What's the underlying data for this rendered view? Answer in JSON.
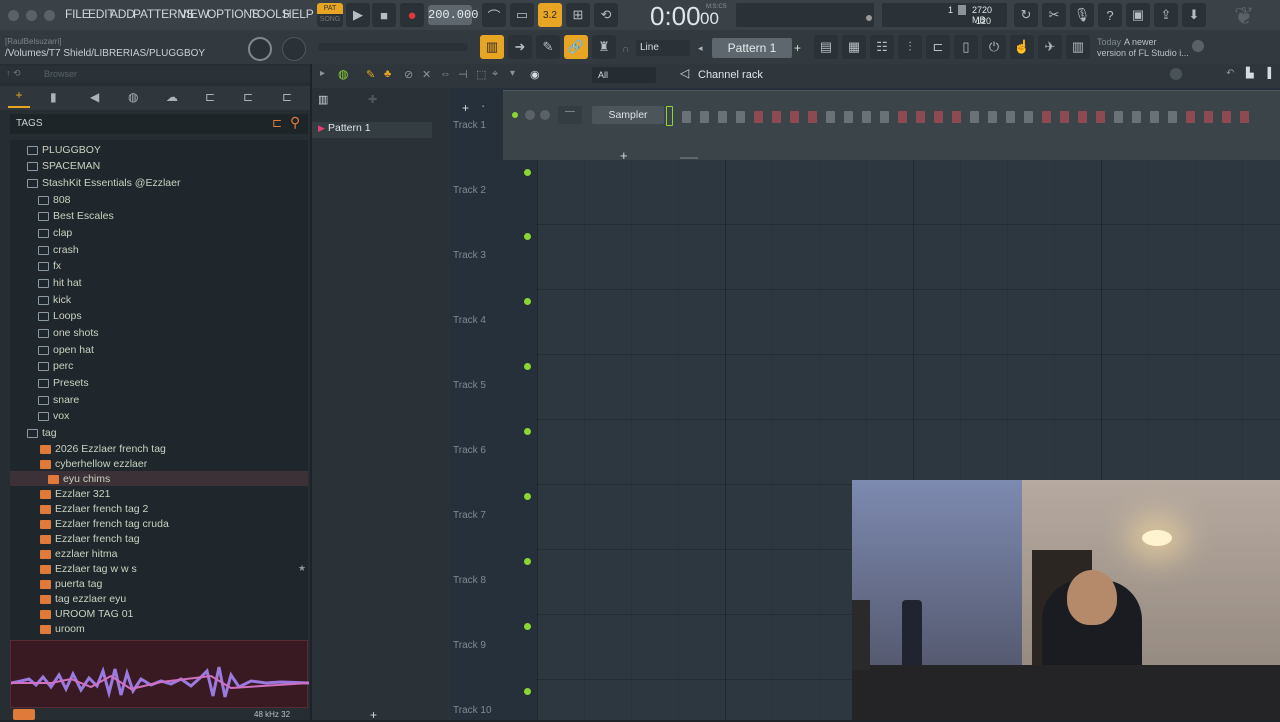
{
  "menu": {
    "items": [
      "FILE",
      "EDIT",
      "ADD",
      "PATTERNS",
      "VIEW",
      "OPTIONS",
      "TOOLS",
      "HELP"
    ]
  },
  "transport": {
    "pat_label": "PAT",
    "song_label": "SONG",
    "tempo": "200.000",
    "time": "0:00",
    "time_small": "00",
    "mcs": "M:S:CS",
    "snap_value": "3.2",
    "counter": "1",
    "memory": "2720 MB",
    "polyphony": "120"
  },
  "toolbar2": {
    "user": "[RaulBelsuzarri]",
    "path": "/Volumes/T7 Shield/LIBRERIAS/PLUGGBOY",
    "snap_mode": "Line",
    "pattern_name": "Pattern 1",
    "news_when": "Today",
    "news_text_1": "A newer",
    "news_text_2": "version of FL Studio i..."
  },
  "browser": {
    "title": "Browser",
    "tags_label": "TAGS",
    "folders": [
      {
        "label": "PLUGGBOY",
        "level": 0
      },
      {
        "label": "SPACEMAN",
        "level": 0
      },
      {
        "label": "StashKit Essentials @Ezzlaer",
        "level": 0
      },
      {
        "label": "808",
        "level": 1
      },
      {
        "label": "Best Escales",
        "level": 1
      },
      {
        "label": "clap",
        "level": 1
      },
      {
        "label": "crash",
        "level": 1
      },
      {
        "label": "fx",
        "level": 1
      },
      {
        "label": "hit hat",
        "level": 1
      },
      {
        "label": "kick",
        "level": 1
      },
      {
        "label": "Loops",
        "level": 1
      },
      {
        "label": "one shots",
        "level": 1
      },
      {
        "label": "open hat",
        "level": 1
      },
      {
        "label": "perc",
        "level": 1
      },
      {
        "label": "Presets",
        "level": 1
      },
      {
        "label": "snare",
        "level": 1
      },
      {
        "label": "vox",
        "level": 1
      },
      {
        "label": "tag",
        "level": 0
      }
    ],
    "tag_items": [
      "2026 Ezzlaer french tag",
      "cyberhellow ezzlaer",
      "eyu chims",
      "Ezzlaer 321",
      "Ezzlaer french tag 2",
      "Ezzlaer french tag cruda",
      "Ezzlaer french tag",
      "ezzlaer hitma",
      "Ezzlaer tag w w s",
      "puerta tag",
      "tag ezzlaer eyu",
      "UROOM TAG 01",
      "uroom"
    ],
    "sample_info": "48 kHz 32"
  },
  "channel_rack": {
    "filter": "All",
    "title": "Channel rack",
    "channel_name": "Sampler"
  },
  "patterns": [
    "Pattern 1"
  ],
  "playlist": {
    "tracks": [
      "Track 1",
      "Track 2",
      "Track 3",
      "Track 4",
      "Track 5",
      "Track 6",
      "Track 7",
      "Track 8",
      "Track 9",
      "Track 10"
    ]
  },
  "colors": {
    "accent": "#e8a423",
    "green": "#8cd534",
    "folder_orange": "#e07a3a"
  }
}
